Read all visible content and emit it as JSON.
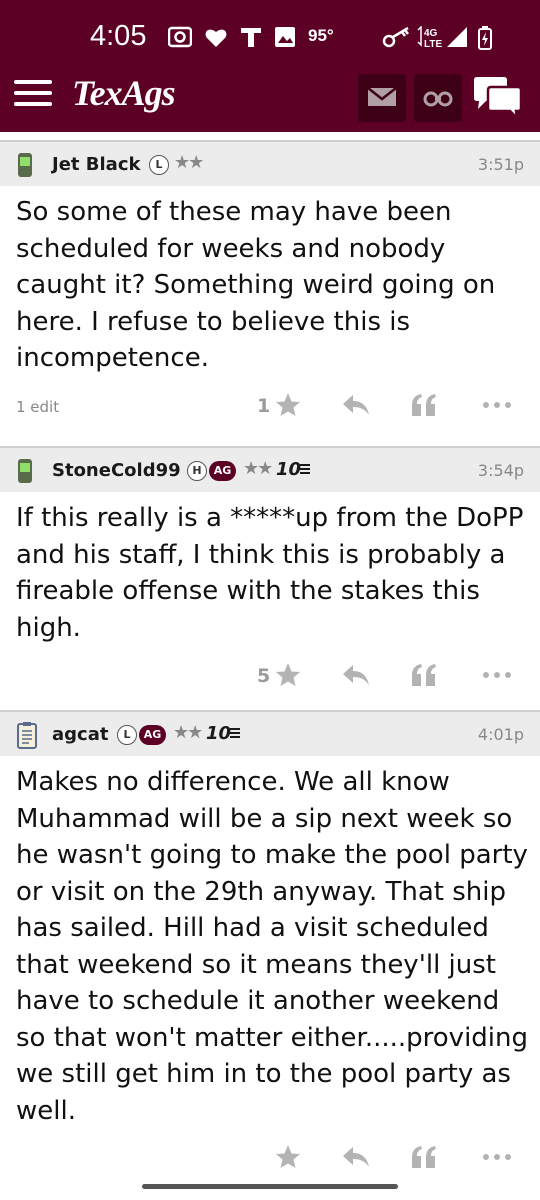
{
  "status_bar": {
    "time": "4:05",
    "temperature": "95°",
    "network": "4G LTE"
  },
  "app": {
    "logo": "TexAgs"
  },
  "nav": {
    "icons": [
      "menu-icon",
      "mail-icon",
      "binoculars-icon",
      "chat-icon"
    ]
  },
  "colors": {
    "brand": "#5c0025",
    "header_gray": "#ececec",
    "muted": "#9a9a9a"
  },
  "posts": [
    {
      "username": "Jet Black",
      "badges": [
        "L"
      ],
      "stars": "★★",
      "time": "3:51p",
      "device_icon": "phone-icon",
      "body": "So some of these may have been scheduled for weeks and nobody caught it? Something weird going on here. I refuse to believe this is incompetence.",
      "edit_note": "1 edit",
      "star_count": "1"
    },
    {
      "username": "StoneCold99",
      "badges": [
        "H",
        "AG"
      ],
      "stars": "★★",
      "rank": "10",
      "time": "3:54p",
      "device_icon": "phone-icon",
      "body": "If this really is a *****up from the DoPP and his staff, I think this is probably a fireable offense with the stakes this high.",
      "edit_note": "",
      "star_count": "5"
    },
    {
      "username": "agcat",
      "badges": [
        "L",
        "AG"
      ],
      "stars": "★★",
      "rank": "10",
      "time": "4:01p",
      "device_icon": "notepad-icon",
      "body": "Makes no difference. We all know Muhammad will be a sip next week so he wasn't going to make the pool party or visit on the 29th anyway. That ship has sailed. Hill had a visit scheduled that weekend so it means they'll just have to schedule it another weekend so that won't matter either.....providing we still get him in to the pool party as well.",
      "edit_note": "",
      "star_count": ""
    }
  ]
}
